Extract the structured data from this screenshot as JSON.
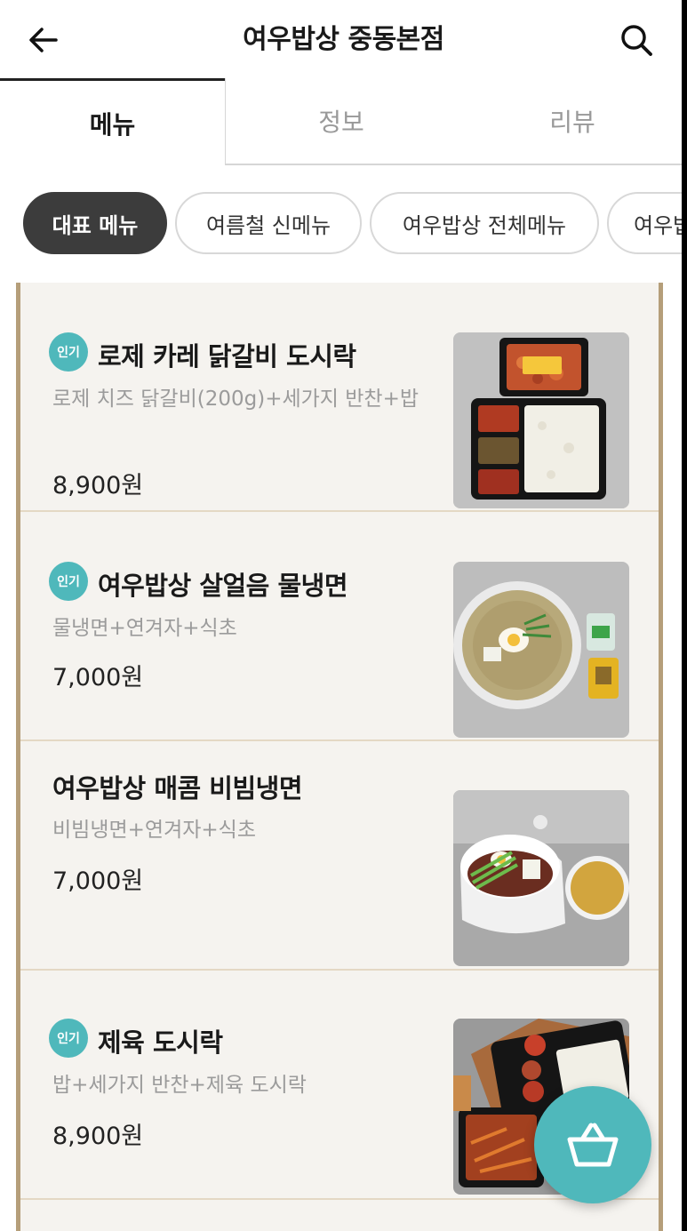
{
  "header": {
    "title": "여우밥상 중동본점",
    "back_icon": "arrow-left-icon",
    "search_icon": "search-icon"
  },
  "tabs": [
    {
      "label": "메뉴",
      "active": true
    },
    {
      "label": "정보",
      "active": false
    },
    {
      "label": "리뷰",
      "active": false
    }
  ],
  "categories": [
    {
      "label": "대표 메뉴",
      "active": true
    },
    {
      "label": "여름철 신메뉴",
      "active": false
    },
    {
      "label": "여우밥상 전체메뉴",
      "active": false
    },
    {
      "label": "여우밥",
      "active": false
    }
  ],
  "menu_items": [
    {
      "badge": "인기",
      "name": "로제 카레 닭갈비 도시락",
      "desc": "로제 치즈 닭갈비(200g)+세가지 반찬+밥",
      "price": "8,900원",
      "image": "rose-curry-dakgalbi-lunchbox-photo"
    },
    {
      "badge": "인기",
      "name": "여우밥상 살얼음 물냉면",
      "desc": "물냉면+연겨자+식초",
      "price": "7,000원",
      "image": "naengmyeon-photo"
    },
    {
      "badge": "",
      "name": "여우밥상 매콤 비빔냉면",
      "desc": "비빔냉면+연겨자+식초",
      "price": "7,000원",
      "image": "bibim-naengmyeon-photo"
    },
    {
      "badge": "인기",
      "name": "제육 도시락",
      "desc": "밥+세가지 반찬+제육 도시락",
      "price": "8,900원",
      "image": "jeyuk-lunchbox-photo"
    }
  ],
  "cart": {
    "icon": "shopping-basket-icon"
  },
  "colors": {
    "accent": "#4fb8bb",
    "panel_border": "#b59e7a",
    "chip_active": "#3c3c3c"
  }
}
